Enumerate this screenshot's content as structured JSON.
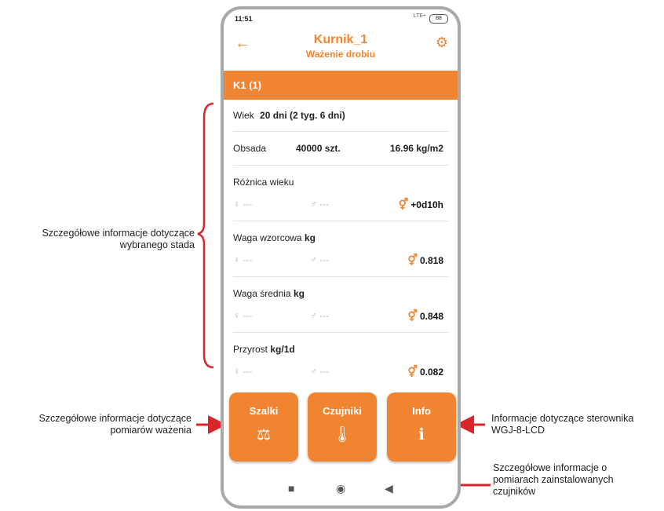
{
  "status": {
    "time": "11:51",
    "signal": "LTE+",
    "battery": "88"
  },
  "header": {
    "title": "Kurnik_1",
    "subtitle": "Ważenie drobiu",
    "back_icon": "arrow-left-icon",
    "settings_icon": "gear-icon"
  },
  "flock_bar": "K1 (1)",
  "age": {
    "label": "Wiek",
    "value": "20 dni (2 tyg. 6 dni)"
  },
  "stocking": {
    "label": "Obsada",
    "count": "40000 szt.",
    "density": "16.96 kg/m2"
  },
  "blocks": [
    {
      "label": "Różnica wieku",
      "unit": "",
      "female": "---",
      "male": "---",
      "mixed": "+0d10h"
    },
    {
      "label": "Waga wzorcowa",
      "unit": "kg",
      "female": "---",
      "male": "---",
      "mixed": "0.818"
    },
    {
      "label": "Waga średnia",
      "unit": "kg",
      "female": "---",
      "male": "---",
      "mixed": "0.848"
    },
    {
      "label": "Przyrost",
      "unit": "kg/1d",
      "female": "---",
      "male": "---",
      "mixed": "0.082"
    }
  ],
  "symbols": {
    "female": "♀",
    "male": "♂",
    "mixed": "⚥"
  },
  "buttons": [
    {
      "label": "Szalki",
      "icon": "scale-icon",
      "glyph": "⚖"
    },
    {
      "label": "Czujniki",
      "icon": "thermometer-icon",
      "glyph": "🌡"
    },
    {
      "label": "Info",
      "icon": "info-icon",
      "glyph": "ℹ"
    }
  ],
  "annotations": {
    "flock_details": [
      "Szczegółowe informacje dotyczące",
      "wybranego stada"
    ],
    "weighing_details": [
      "Szczegółowe informacje dotyczące",
      "pomiarów ważenia"
    ],
    "controller_info": [
      "Informacje dotyczące sterownika",
      "WGJ-8-LCD"
    ],
    "sensor_details": [
      "Szczegółowe informacje o",
      "pomiarach zainstalowanych",
      "czujników"
    ]
  },
  "colors": {
    "accent": "#f08431",
    "annotation_red": "#d9262c"
  }
}
